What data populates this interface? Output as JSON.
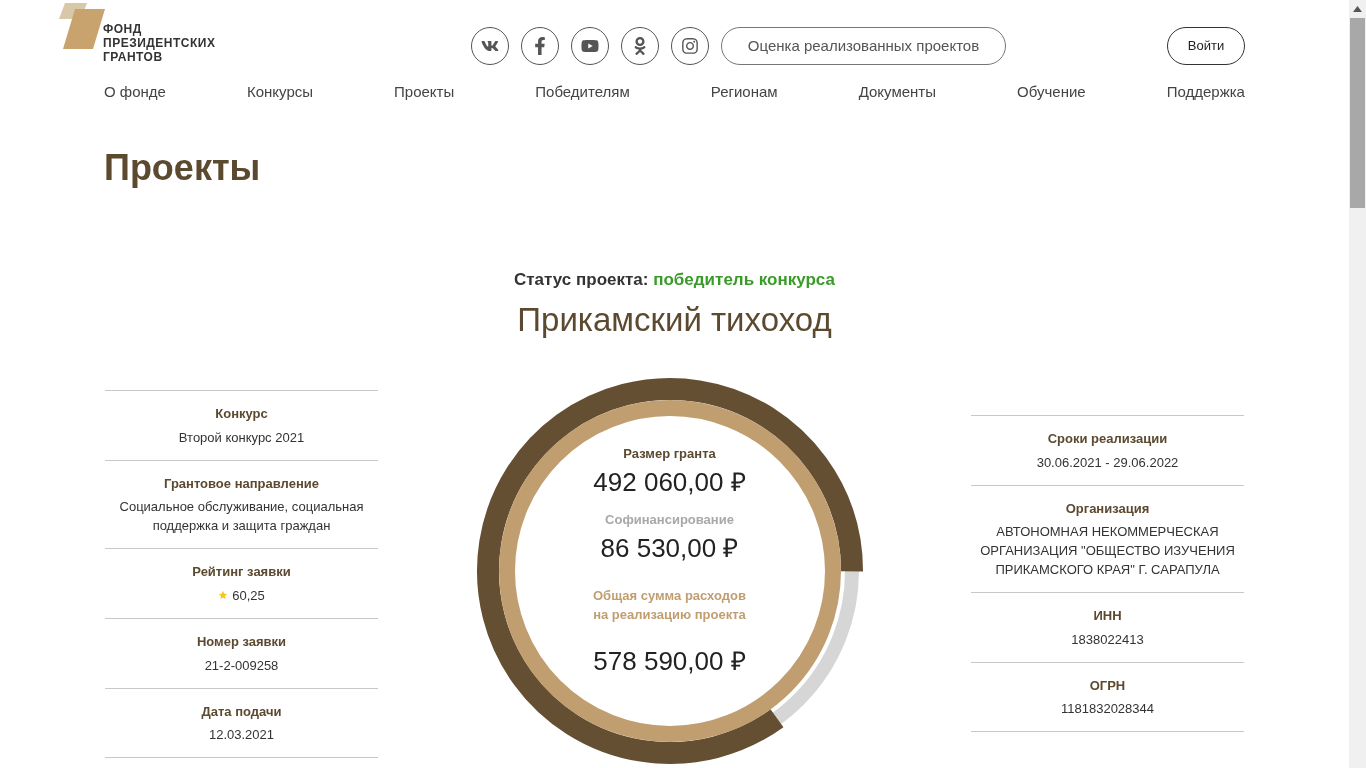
{
  "logo": {
    "lines": [
      "ФОНД",
      "ПРЕЗИДЕНТСКИХ",
      "ГРАНТОВ"
    ]
  },
  "socials": [
    {
      "kind": "vk"
    },
    {
      "kind": "facebook"
    },
    {
      "kind": "youtube"
    },
    {
      "kind": "ok"
    },
    {
      "kind": "instagram"
    }
  ],
  "evaluation_button": "Оценка реализованных проектов",
  "login_button": "Войти",
  "nav": [
    "О фонде",
    "Конкурсы",
    "Проекты",
    "Победителям",
    "Регионам",
    "Документы",
    "Обучение",
    "Поддержка"
  ],
  "page_title": "Проекты",
  "status": {
    "label": "Статус проекта:",
    "value": "победитель конкурса"
  },
  "project_name": "Прикамский тихоход",
  "left_info": [
    {
      "label": "Конкурс",
      "value": "Второй конкурс 2021"
    },
    {
      "label": "Грантовое направление",
      "value": "Социальное обслуживание, социальная поддержка и защита граждан"
    },
    {
      "label": "Рейтинг заявки",
      "value": "60,25",
      "kind": "rating"
    },
    {
      "label": "Номер заявки",
      "value": "21-2-009258"
    },
    {
      "label": "Дата подачи",
      "value": "12.03.2021"
    }
  ],
  "budget": {
    "level": 0.85,
    "items": [
      {
        "label": "Размер гранта",
        "value": "492 060,00 ₽",
        "kind": "grant"
      },
      {
        "label": "Софинансирование",
        "value": "86 530,00 ₽",
        "kind": "cofinancing"
      },
      {
        "label": "Общая сумма расходов на реализацию проекта",
        "value": "578 590,00 ₽",
        "kind": "total"
      }
    ]
  },
  "right_info": [
    {
      "label": "Сроки реализации",
      "value": "30.06.2021 - 29.06.2022"
    },
    {
      "label": "Организация",
      "value": "АВТОНОМНАЯ НЕКОММЕРЧЕСКАЯ ОРГАНИЗАЦИЯ \"ОБЩЕСТВО ИЗУЧЕНИЯ ПРИКАМСКОГО КРАЯ\" Г. САРАПУЛА"
    },
    {
      "label": "ИНН",
      "value": "1838022413"
    },
    {
      "label": "ОГРН",
      "value": "1181832028344"
    }
  ]
}
